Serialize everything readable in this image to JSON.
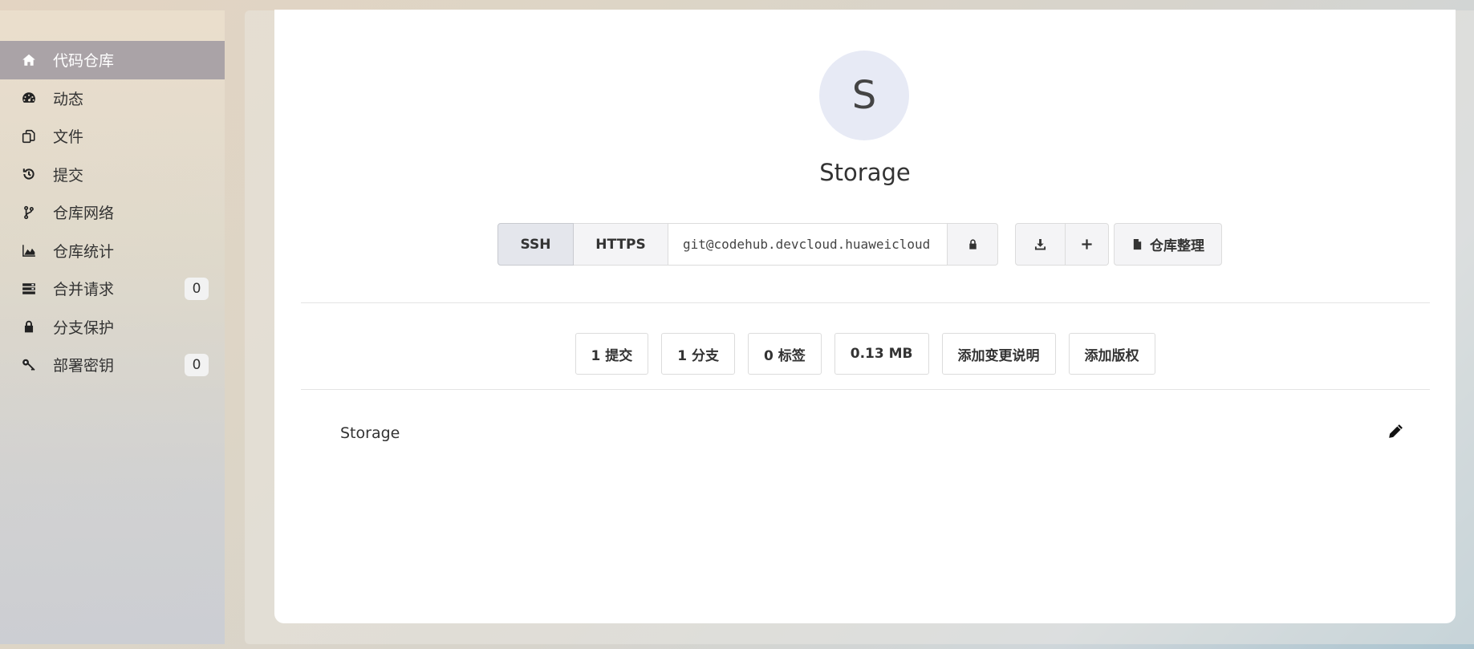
{
  "sidebar": {
    "items": [
      {
        "label": "代码仓库",
        "icon": "home-icon",
        "active": true
      },
      {
        "label": "动态",
        "icon": "dashboard-icon"
      },
      {
        "label": "文件",
        "icon": "files-icon"
      },
      {
        "label": "提交",
        "icon": "history-icon"
      },
      {
        "label": "仓库网络",
        "icon": "branch-icon"
      },
      {
        "label": "仓库统计",
        "icon": "area-chart-icon"
      },
      {
        "label": "合并请求",
        "icon": "merge-list-icon",
        "badge": "0"
      },
      {
        "label": "分支保护",
        "icon": "lock-icon"
      },
      {
        "label": "部署密钥",
        "icon": "key-icon",
        "badge": "0"
      }
    ]
  },
  "repo": {
    "avatar_letter": "S",
    "name": "Storage"
  },
  "clone": {
    "ssh_label": "SSH",
    "https_label": "HTTPS",
    "url": "git@codehub.devcloud.huaweicloud",
    "tidy_label": "仓库整理"
  },
  "stats": {
    "commits": "1 提交",
    "branches": "1 分支",
    "tags": "0 标签",
    "size": "0.13 MB",
    "add_changelog": "添加变更说明",
    "add_license": "添加版权"
  },
  "readme": {
    "title": "Storage"
  },
  "colors": {
    "active_nav_bg": "#aaa3a7",
    "avatar_bg": "#e7eaf5"
  }
}
